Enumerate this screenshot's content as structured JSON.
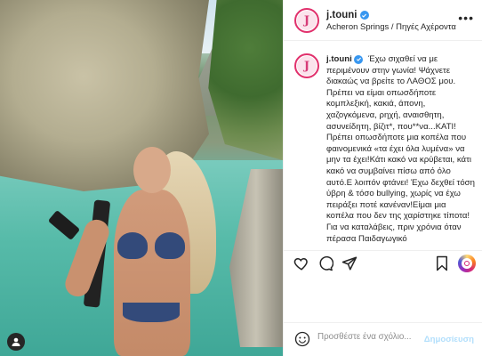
{
  "post": {
    "username": "j.touni",
    "avatar_letter": "J",
    "location": "Acheron Springs / Πηγές Αχέροντα",
    "more_label": "•••"
  },
  "caption": {
    "username": "j.touni",
    "text": "Έχω σιχαθεί να με περιμένουν στην γωνία! Ψάχνετε διακαώς να βρείτε το ΛΑΘΟΣ μου. Πρέπει να είμαι οπωσδήποτε κομπλεξική, κακιά, άπονη, χαζογκόμενα, ρηχή, αναισθητη, ασυνείδητη, βίζιτ*, που**να...ΚΑΤΙ! Πρέπει οπωσδήποτε μια κοπέλα που φαινομενικά «τα έχει όλα λυμένα» να μην τα έχει!Κάτι κακό να κρύβεται, κάτι κακό να συμβαίνει πίσω από όλο αυτό.Ε λοιπόν φτάνει! Έχω δεχθεί τόση ύβρη & τόσο bullying, χωρίς να έχω πειράξει ποτέ κανέναν!Είμαι μια κοπέλα που δεν της χαρίστηκε τίποτα! Για να καταλάβεις, πριν χρόνια όταν πέρασα Παιδαγωγικό"
  },
  "comment": {
    "placeholder": "Προσθέστε ένα σχόλιο...",
    "post_label": "Δημοσίευση"
  },
  "colors": {
    "verified": "#3897f0",
    "post_button_disabled": "#b2dffc",
    "avatar_ring": "#e1306c"
  },
  "icons": [
    "user-icon",
    "verified-icon",
    "more-icon",
    "heart-icon",
    "comment-icon",
    "share-icon",
    "bookmark-icon",
    "igtv-icon",
    "emoji-icon"
  ]
}
